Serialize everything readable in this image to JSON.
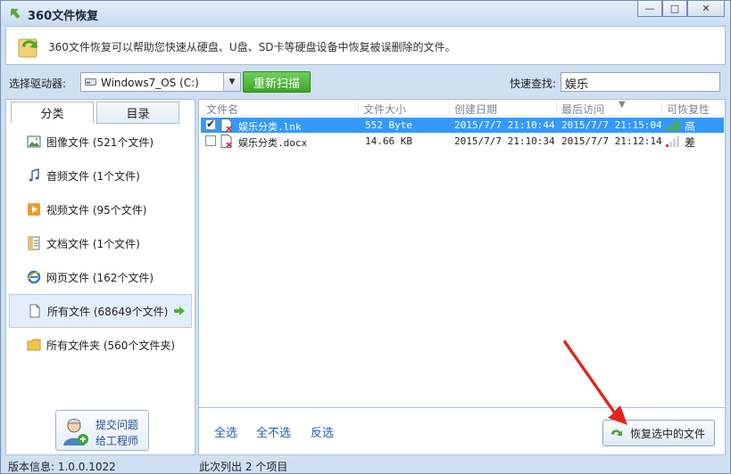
{
  "window": {
    "title": "360文件恢复",
    "controls": {
      "minimize": "—",
      "maximize": "□",
      "close": "✕"
    }
  },
  "header": {
    "description": "360文件恢复可以帮助您快速从硬盘、U盘、SD卡等硬盘设备中恢复被误删除的文件。"
  },
  "toolbar": {
    "drive_label": "选择驱动器:",
    "drive_value": "Windows7_OS (C:)",
    "rescan_label": "重新扫描",
    "search_label": "快速查找:",
    "search_value": "娱乐"
  },
  "left": {
    "tabs": [
      {
        "label": "分类",
        "active": true
      },
      {
        "label": "目录",
        "active": false
      }
    ],
    "categories": [
      {
        "label": "图像文件 (521个文件)",
        "icon": "image-icon"
      },
      {
        "label": "音频文件 (1个文件)",
        "icon": "music-icon"
      },
      {
        "label": "视频文件 (95个文件)",
        "icon": "video-icon"
      },
      {
        "label": "文档文件 (1个文件)",
        "icon": "document-icon"
      },
      {
        "label": "网页文件 (162个文件)",
        "icon": "ie-icon"
      },
      {
        "label": "所有文件 (68649个文件)",
        "icon": "file-icon",
        "active": true
      },
      {
        "label": "所有文件夹 (560个文件夹)",
        "icon": "folder-icon"
      }
    ],
    "engineer": {
      "line1": "提交问题",
      "line2": "给工程师"
    }
  },
  "table": {
    "headers": [
      "文件名",
      "文件大小",
      "创建日期",
      "最后访问",
      "可恢复性"
    ],
    "rows": [
      {
        "name": "娱乐分类.lnk",
        "size": "552 Byte",
        "created": "2015/7/7 21:10:44",
        "accessed": "2015/7/7 21:15:04",
        "recoverability": "高",
        "checked": true,
        "selected": true
      },
      {
        "name": "娱乐分类.docx",
        "size": "14.66 KB",
        "created": "2015/7/7 21:10:34",
        "accessed": "2015/7/7 21:12:14",
        "recoverability": "差",
        "checked": false,
        "selected": false
      }
    ]
  },
  "actions": {
    "select_all": "全选",
    "select_none": "全不选",
    "invert": "反选",
    "recover": "恢复选中的文件"
  },
  "status": {
    "version": "版本信息: 1.0.0.1022",
    "count": "此次列出 2 个项目"
  },
  "colors": {
    "selected_row": "#3399ff",
    "rescan_green": "#3ea62a",
    "link_blue": "#1d5fb3"
  }
}
